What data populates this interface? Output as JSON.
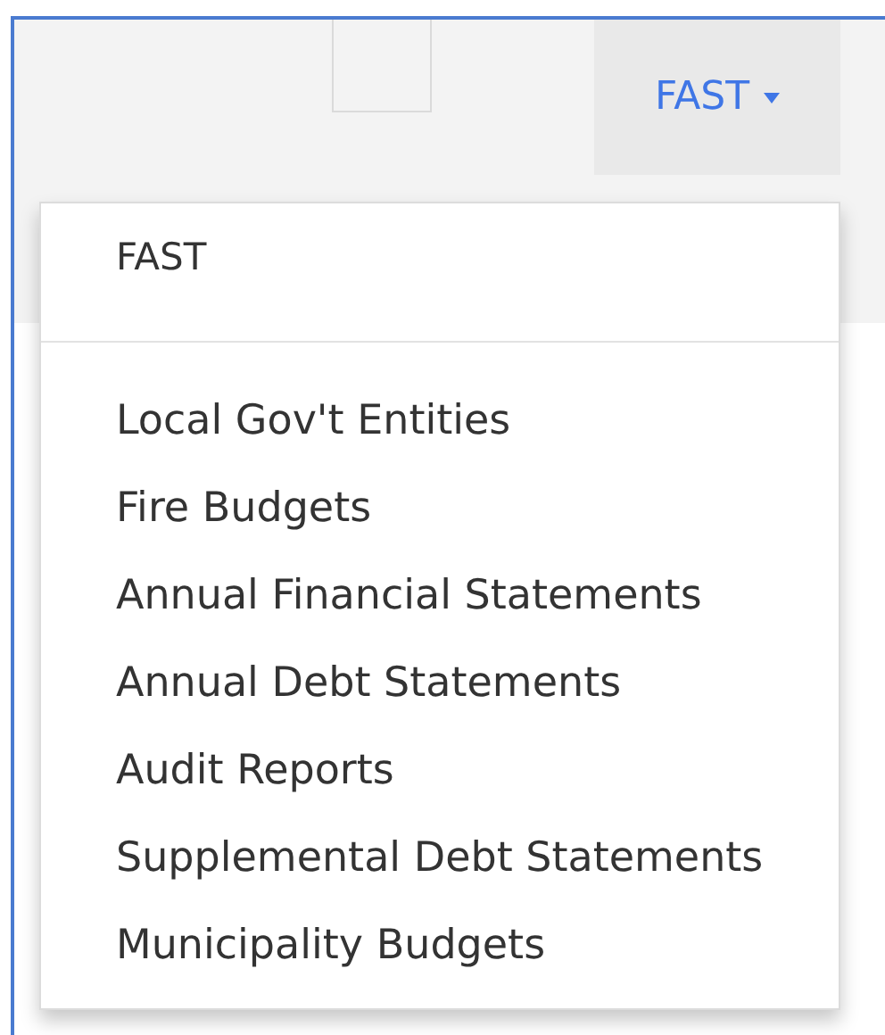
{
  "nav_menu": {
    "label": "FAST",
    "expanded": true,
    "menu": {
      "heading": "FAST",
      "items": [
        "Local Gov't Entities",
        "Fire Budgets",
        "Annual Financial Statements",
        "Annual Debt Statements",
        "Audit Reports",
        "Supplemental Debt Statements",
        "Municipality Budgets"
      ]
    }
  }
}
